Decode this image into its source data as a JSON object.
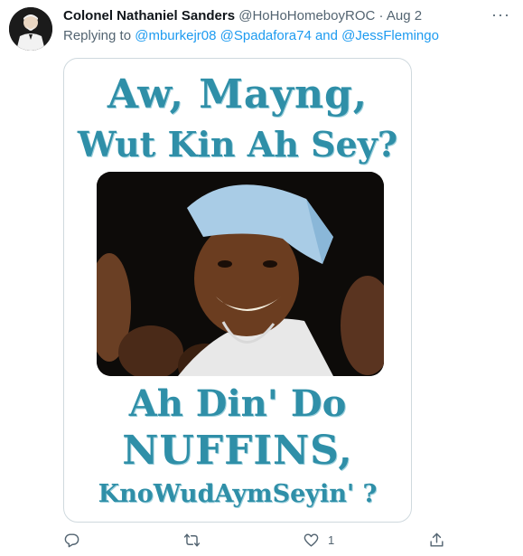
{
  "tweet": {
    "author_name": "Colonel Nathaniel Sanders",
    "handle": "@HoHoHomeboyROC",
    "separator": "·",
    "date": "Aug 2",
    "more": "···",
    "replying_prefix": "Replying to",
    "mentions": [
      "@mburkejr08",
      "@Spadafora74"
    ],
    "and_word": "and",
    "last_mention": "@JessFlemingo"
  },
  "meme": {
    "line1": "Aw, Mayng,",
    "line2": "Wut Kin Ah Sey?",
    "line3": "Ah Din' Do",
    "line4": "NUFFINS,",
    "line5": "KnoWudAymSeyin' ?"
  },
  "actions": {
    "reply_icon": "reply-icon",
    "retweet_icon": "retweet-icon",
    "like_icon": "heart-icon",
    "like_count": "1",
    "share_icon": "share-icon"
  }
}
